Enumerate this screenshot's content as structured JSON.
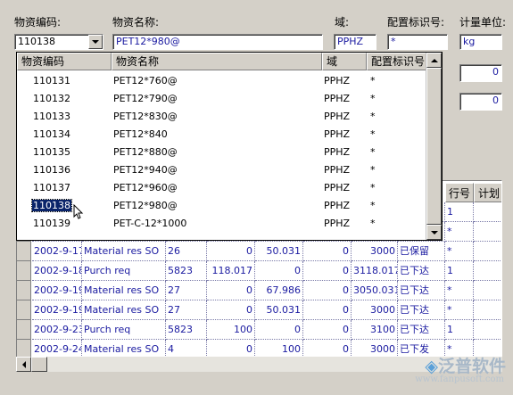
{
  "labels": {
    "code": "物资编码:",
    "name": "物资名称:",
    "domain": "域:",
    "config": "配置标识号:",
    "unit": "计量单位:"
  },
  "fields": {
    "code_value": "110138",
    "name_value": "PET12*980@",
    "domain_value": "PPHZ",
    "config_value": "*",
    "unit_value": "kg",
    "num1": "0",
    "num2": "0"
  },
  "popup": {
    "headers": [
      "物资编码",
      "物资名称",
      "域",
      "配置标识号"
    ],
    "rows": [
      {
        "code": "110131",
        "name": "PET12*760@",
        "domain": "PPHZ",
        "config": "*"
      },
      {
        "code": "110132",
        "name": "PET12*790@",
        "domain": "PPHZ",
        "config": "*"
      },
      {
        "code": "110133",
        "name": "PET12*830@",
        "domain": "PPHZ",
        "config": "*"
      },
      {
        "code": "110134",
        "name": "PET12*840",
        "domain": "PPHZ",
        "config": "*"
      },
      {
        "code": "110135",
        "name": "PET12*880@",
        "domain": "PPHZ",
        "config": "*"
      },
      {
        "code": "110136",
        "name": "PET12*940@",
        "domain": "PPHZ",
        "config": "*"
      },
      {
        "code": "110137",
        "name": "PET12*960@",
        "domain": "PPHZ",
        "config": "*"
      },
      {
        "code": "110138",
        "name": "PET12*980@",
        "domain": "PPHZ",
        "config": "*",
        "selected": true
      },
      {
        "code": "110139",
        "name": "PET-C-12*1000",
        "domain": "PPHZ",
        "config": "*"
      }
    ]
  },
  "grid": {
    "headers_visible": [
      "行号",
      "计划"
    ],
    "rows": [
      {
        "date": "",
        "type": "",
        "qty": "",
        "a": "",
        "b": "",
        "c": "",
        "d": "",
        "status": "",
        "line": "1"
      },
      {
        "date": "",
        "type": "",
        "qty": "",
        "a": "",
        "b": "",
        "c": "",
        "d": "",
        "status": "",
        "line": "*"
      },
      {
        "date": "2002-9-17",
        "type": "Material res SO",
        "qty": "26",
        "a": "0",
        "b": "50.031",
        "c": "0",
        "d": "3000",
        "status": "已保留",
        "line": "*"
      },
      {
        "date": "2002-9-18",
        "type": "Purch req",
        "qty": "5823",
        "a": "118.017",
        "b": "0",
        "c": "0",
        "d": "3118.017",
        "status": "已下达",
        "line": "1"
      },
      {
        "date": "2002-9-19",
        "type": "Material res SO",
        "qty": "27",
        "a": "0",
        "b": "67.986",
        "c": "0",
        "d": "3050.031",
        "status": "已下达",
        "line": "*"
      },
      {
        "date": "2002-9-19",
        "type": "Material res SO",
        "qty": "27",
        "a": "0",
        "b": "50.031",
        "c": "0",
        "d": "3000",
        "status": "已下达",
        "line": "*"
      },
      {
        "date": "2002-9-23",
        "type": "Purch req",
        "qty": "5823",
        "a": "100",
        "b": "0",
        "c": "0",
        "d": "3100",
        "status": "已下达",
        "line": "1"
      },
      {
        "date": "2002-9-24",
        "type": "Material res SO",
        "qty": "4",
        "a": "0",
        "b": "100",
        "c": "0",
        "d": "3000",
        "status": "已下发",
        "line": "*"
      }
    ]
  },
  "watermark": {
    "brand": "泛普软件",
    "url": "www.fanpusoft.com"
  },
  "colors": {
    "face": "#d4d0c8",
    "text_blue": "#1a1aa0",
    "selection": "#0a246a"
  }
}
